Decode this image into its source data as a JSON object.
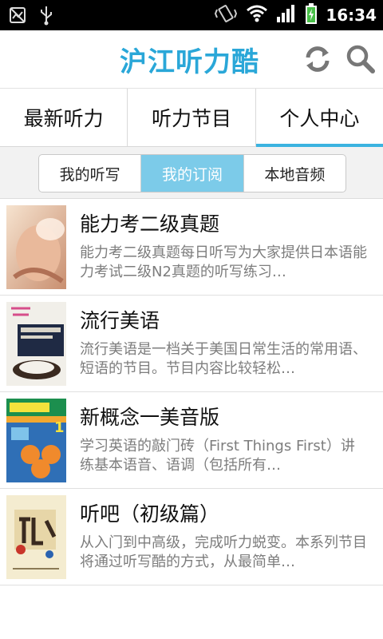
{
  "status_bar": {
    "time": "16:34",
    "icons": [
      "no-sim-icon",
      "usb-icon",
      "vibrate-icon",
      "wifi-icon",
      "signal-icon",
      "battery-charging-icon"
    ]
  },
  "header": {
    "title": "沪江听力酷",
    "actions": [
      "refresh-icon",
      "search-icon"
    ]
  },
  "tabs": [
    {
      "label": "最新听力"
    },
    {
      "label": "听力节目"
    },
    {
      "label": "个人中心",
      "active": true
    }
  ],
  "subtabs": [
    {
      "label": "我的听写"
    },
    {
      "label": "我的订阅",
      "active": true
    },
    {
      "label": "本地音频"
    }
  ],
  "items": [
    {
      "title": "能力考二级真题",
      "desc": "能力考二级真题每日听写为大家提供日本语能力考试二级N2真题的听写练习…"
    },
    {
      "title": "流行美语",
      "desc": "流行美语是一档关于美国日常生活的常用语、短语的节目。节目内容比较轻松…"
    },
    {
      "title": "新概念一美音版",
      "desc": "学习英语的敲门砖（First Things First）讲练基本语音、语调（包括所有…"
    },
    {
      "title": "听吧（初级篇）",
      "desc": "从入门到中高级，完成听力蜕变。本系列节目将通过听写酷的方式，从最简单…"
    }
  ],
  "colors": {
    "accent": "#2aa7d8",
    "tab_indicator": "#3bb3e0",
    "segment_active": "#7ccbe9"
  }
}
